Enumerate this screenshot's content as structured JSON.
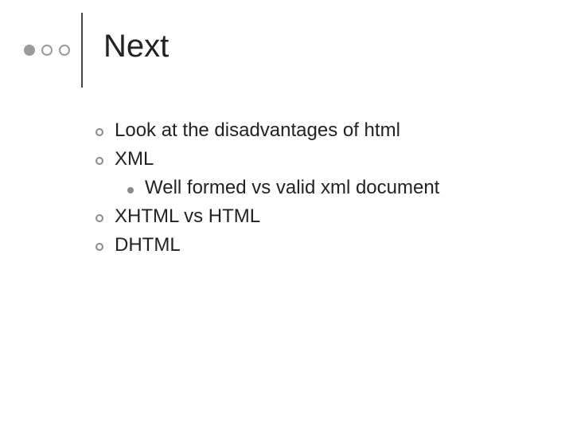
{
  "title": "Next",
  "items": [
    {
      "text": "Look at the disadvantages of html"
    },
    {
      "text": "XML",
      "sub": [
        {
          "text": "Well formed vs valid xml document"
        }
      ]
    },
    {
      "text": "XHTML vs HTML"
    },
    {
      "text": "DHTML"
    }
  ]
}
